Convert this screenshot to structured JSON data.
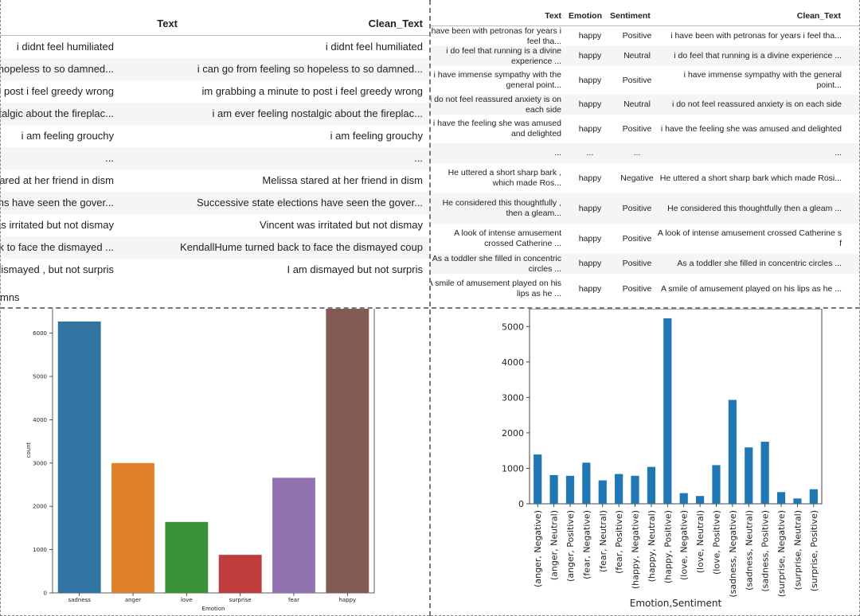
{
  "table1": {
    "headers": [
      "Text",
      "Clean_Text"
    ],
    "rows": [
      [
        "i didnt feel humiliated",
        "i didnt feel humiliated"
      ],
      [
        "i can go from feeling so hopeless to so damned...",
        "i can go from feeling so hopeless to so damned..."
      ],
      [
        "im grabbing a minute to post i feel greedy wrong",
        "im grabbing a minute to post i feel greedy wrong"
      ],
      [
        "i am ever feeling nostalgic about the fireplac...",
        "i am ever feeling nostalgic about the fireplac..."
      ],
      [
        "i am feeling grouchy",
        "i am feeling grouchy"
      ],
      [
        "...",
        "..."
      ],
      [
        "Melissa stared at her friend in dism",
        "Melissa stared at her friend in dism"
      ],
      [
        "Successive state elections have seen the gover...",
        "Successive state elections have seen the gover..."
      ],
      [
        "Vincent was irritated but not dismay",
        "Vincent was irritated but not dismay"
      ],
      [
        "KendallHume turned back to face the dismayed ...",
        "KendallHume turned back to face the dismayed coup"
      ],
      [
        "I am dismayed , but not surpris",
        "I am dismayed but not surpris"
      ]
    ],
    "footer": "mns"
  },
  "table2": {
    "headers": [
      "Text",
      "Emotion",
      "Sentiment",
      "Clean_Text"
    ],
    "rows": [
      [
        "i have been with petronas for years i feel tha...",
        "happy",
        "Positive",
        "i have been with petronas for years i feel tha..."
      ],
      [
        "i do feel that running is a divine experience ...",
        "happy",
        "Neutral",
        "i do feel that running is a divine experience ..."
      ],
      [
        "i have immense sympathy with the general point...",
        "happy",
        "Positive",
        "i have immense sympathy with the general point..."
      ],
      [
        "i do not feel reassured anxiety is on each side",
        "happy",
        "Neutral",
        "i do not feel reassured anxiety is on each side"
      ],
      [
        "i have the feeling she was amused and delighted",
        "happy",
        "Positive",
        "i have the feeling she was amused and delighted"
      ],
      [
        "...",
        "...",
        "...",
        "..."
      ],
      [
        "He uttered a short sharp bark , which made Ros...",
        "happy",
        "Negative",
        "He uttered a short sharp bark which made Rosi..."
      ],
      [
        "He considered this thoughtfully , then a gleam...",
        "happy",
        "Positive",
        "He considered this thoughtfully then a gleam ..."
      ],
      [
        "A look of intense amusement crossed Catherine ...",
        "happy",
        "Positive",
        "A look of intense amusement crossed Catherine s f"
      ],
      [
        "As a toddler she filled in concentric circles ...",
        "happy",
        "Positive",
        "As a toddler she filled in concentric circles ..."
      ],
      [
        "A smile of amusement played on his lips as he ...",
        "happy",
        "Positive",
        "A smile of amusement played on his lips as he ..."
      ]
    ]
  },
  "chart_data": [
    {
      "type": "bar",
      "categories": [
        "sadness",
        "anger",
        "love",
        "surprise",
        "fear",
        "happy"
      ],
      "values": [
        6270,
        3000,
        1640,
        880,
        2660,
        6600
      ],
      "colors": [
        "#3274a1",
        "#e1812c",
        "#3a923a",
        "#c03d3e",
        "#9372b2",
        "#845b53"
      ],
      "xlabel": "Emotion",
      "ylabel": "count",
      "yticks": [
        0,
        1000,
        2000,
        3000,
        4000,
        5000,
        6000
      ],
      "ylim": [
        0,
        6600
      ],
      "grid": false
    },
    {
      "type": "bar",
      "categories": [
        "(anger, Negative)",
        "(anger, Neutral)",
        "(anger, Positive)",
        "(fear, Negative)",
        "(fear, Neutral)",
        "(fear, Positive)",
        "(happy, Negative)",
        "(happy, Neutral)",
        "(happy, Positive)",
        "(love, Negative)",
        "(love, Neutral)",
        "(love, Positive)",
        "(sadness, Negative)",
        "(sadness, Neutral)",
        "(sadness, Positive)",
        "(surprise, Negative)",
        "(surprise, Neutral)",
        "(surprise, Positive)"
      ],
      "values": [
        1390,
        810,
        790,
        1160,
        660,
        840,
        790,
        1040,
        5230,
        300,
        220,
        1090,
        2930,
        1590,
        1750,
        330,
        150,
        410
      ],
      "color": "#1f77b4",
      "xlabel": "Emotion,Sentiment",
      "ylabel": "",
      "yticks": [
        0,
        1000,
        2000,
        3000,
        4000,
        5000
      ],
      "ylim": [
        0,
        5500
      ],
      "grid": false
    }
  ]
}
